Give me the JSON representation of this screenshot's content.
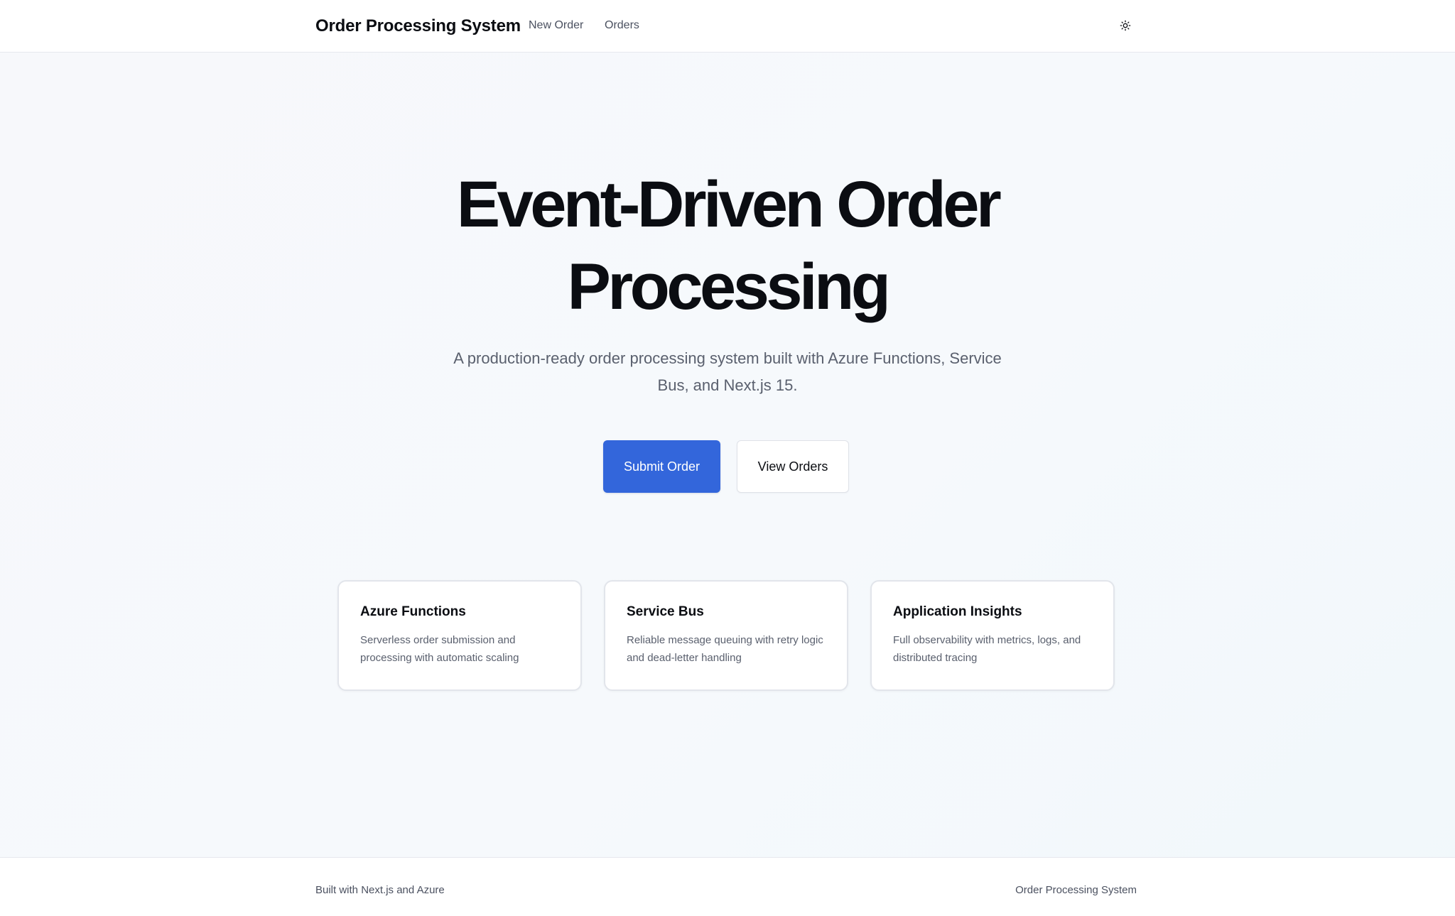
{
  "header": {
    "brand": "Order Processing System",
    "nav": {
      "new_order": "New Order",
      "orders": "Orders"
    },
    "theme_toggle_icon": "sun-icon"
  },
  "hero": {
    "title_line1": "Event-Driven Order",
    "title_line2": "Processing",
    "subtitle": "A production-ready order processing system built with Azure Functions, Service Bus, and Next.js 15.",
    "primary_button": "Submit Order",
    "secondary_button": "View Orders"
  },
  "features": [
    {
      "title": "Azure Functions",
      "description": "Serverless order submission and processing with automatic scaling"
    },
    {
      "title": "Service Bus",
      "description": "Reliable message queuing with retry logic and dead-letter handling"
    },
    {
      "title": "Application Insights",
      "description": "Full observability with metrics, logs, and distributed tracing"
    }
  ],
  "footer": {
    "left": "Built with Next.js and Azure",
    "right": "Order Processing System"
  },
  "colors": {
    "accent": "#3366db",
    "text": "#0b0d12",
    "muted": "#5a606e"
  }
}
